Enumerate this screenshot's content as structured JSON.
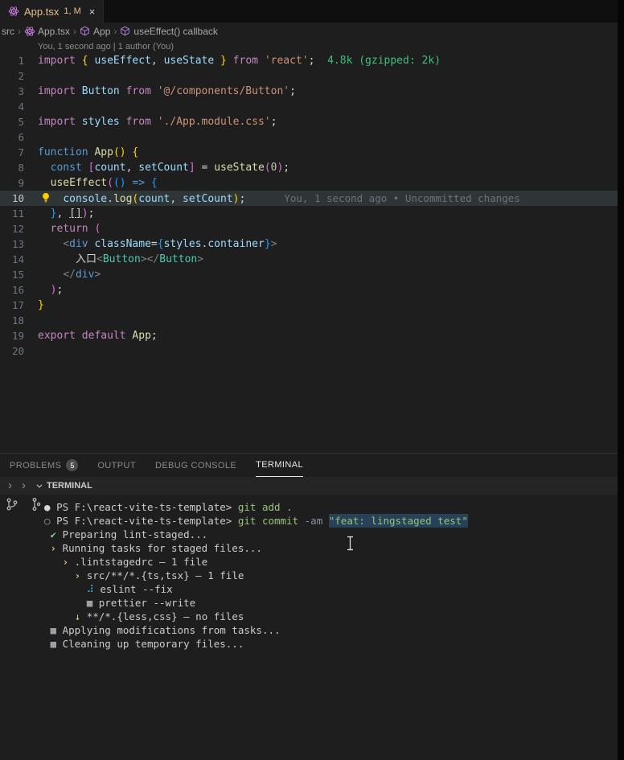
{
  "tab": {
    "title": "App.tsx",
    "badge": "1, M",
    "close_glyph": "×",
    "icon": "react-icon"
  },
  "breadcrumbs": {
    "separator": "›",
    "items": [
      {
        "label": "src"
      },
      {
        "label": "App.tsx",
        "icon": "react"
      },
      {
        "label": "App",
        "icon": "method"
      },
      {
        "label": "useEffect() callback",
        "icon": "method"
      }
    ]
  },
  "editor": {
    "codelens": "You, 1 second ago | 1 author (You)",
    "import_cost": "4.8k (gzipped: 2k)",
    "blame_annotation": "You, 1 second ago • Uncommitted changes",
    "lines": [
      {
        "n": 1,
        "t": [
          [
            "import ",
            "kw"
          ],
          [
            "{ ",
            "b1"
          ],
          [
            "useEffect",
            "var"
          ],
          [
            ", ",
            "pun"
          ],
          [
            "useState",
            "var"
          ],
          [
            " } ",
            "b1"
          ],
          [
            "from ",
            "kw"
          ],
          [
            "'react'",
            "str"
          ],
          [
            ";",
            "pun"
          ],
          [
            "  4.8k (gzipped: 2k)",
            "cost"
          ]
        ]
      },
      {
        "n": 2,
        "t": []
      },
      {
        "n": 3,
        "t": [
          [
            "import ",
            "kw"
          ],
          [
            "Button",
            "var"
          ],
          [
            " from ",
            "kw"
          ],
          [
            "'@/components/Button'",
            "str"
          ],
          [
            ";",
            "pun"
          ]
        ]
      },
      {
        "n": 4,
        "t": []
      },
      {
        "n": 5,
        "t": [
          [
            "import ",
            "kw"
          ],
          [
            "styles",
            "var"
          ],
          [
            " from ",
            "kw"
          ],
          [
            "'./App.module.css'",
            "str"
          ],
          [
            ";",
            "pun"
          ]
        ]
      },
      {
        "n": 6,
        "t": []
      },
      {
        "n": 7,
        "t": [
          [
            "function ",
            "kw2"
          ],
          [
            "App",
            "fn"
          ],
          [
            "() {",
            "b1"
          ]
        ]
      },
      {
        "n": 8,
        "t": [
          [
            "  ",
            "pun"
          ],
          [
            "const ",
            "kw2"
          ],
          [
            "[",
            "b2"
          ],
          [
            "count",
            "var"
          ],
          [
            ", ",
            "pun"
          ],
          [
            "setCount",
            "var"
          ],
          [
            "]",
            "b2"
          ],
          [
            " = ",
            "pun"
          ],
          [
            "useState",
            "fn"
          ],
          [
            "(",
            "b2"
          ],
          [
            "0",
            "num"
          ],
          [
            ")",
            "b2"
          ],
          [
            ";",
            "pun"
          ]
        ]
      },
      {
        "n": 9,
        "t": [
          [
            "  ",
            "pun"
          ],
          [
            "useEffect",
            "fn"
          ],
          [
            "(",
            "b2"
          ],
          [
            "()",
            "b3"
          ],
          [
            " ",
            "pun"
          ],
          [
            "=>",
            "kw2"
          ],
          [
            " ",
            "pun"
          ],
          [
            "{",
            "b3"
          ]
        ]
      },
      {
        "n": 10,
        "current": true,
        "lightbulb": true,
        "blame": "You, 1 second ago • Uncommitted changes",
        "t": [
          [
            "    ",
            "pun"
          ],
          [
            "console",
            "var"
          ],
          [
            ".",
            "pun"
          ],
          [
            "log",
            "fn"
          ],
          [
            "(",
            "b1"
          ],
          [
            "count",
            "var"
          ],
          [
            ", ",
            "pun"
          ],
          [
            "setCount",
            "var"
          ],
          [
            ")",
            "b1"
          ],
          [
            ";",
            "pun"
          ]
        ]
      },
      {
        "n": 11,
        "t": [
          [
            "  ",
            "pun"
          ],
          [
            "}",
            "b3"
          ],
          [
            ", ",
            "pun"
          ],
          [
            "[]",
            "lnk"
          ],
          [
            ")",
            "b2"
          ],
          [
            ";",
            "pun"
          ]
        ]
      },
      {
        "n": 12,
        "t": [
          [
            "  ",
            "pun"
          ],
          [
            "return ",
            "kw"
          ],
          [
            "(",
            "b2"
          ]
        ]
      },
      {
        "n": 13,
        "t": [
          [
            "    ",
            "pun"
          ],
          [
            "<",
            "jsxp"
          ],
          [
            "div",
            "tag"
          ],
          [
            " ",
            "pun"
          ],
          [
            "className",
            "var"
          ],
          [
            "=",
            "pun"
          ],
          [
            "{",
            "b3"
          ],
          [
            "styles",
            "var"
          ],
          [
            ".",
            "pun"
          ],
          [
            "container",
            "var"
          ],
          [
            "}",
            "b3"
          ],
          [
            ">",
            "jsxp"
          ]
        ]
      },
      {
        "n": 14,
        "t": [
          [
            "      ",
            "pun"
          ],
          [
            "入口",
            "plain"
          ],
          [
            "<",
            "jsxp"
          ],
          [
            "Button",
            "comp"
          ],
          [
            "></",
            "jsxp"
          ],
          [
            "Button",
            "comp"
          ],
          [
            ">",
            "jsxp"
          ]
        ]
      },
      {
        "n": 15,
        "t": [
          [
            "    ",
            "pun"
          ],
          [
            "</",
            "jsxp"
          ],
          [
            "div",
            "tag"
          ],
          [
            ">",
            "jsxp"
          ]
        ]
      },
      {
        "n": 16,
        "t": [
          [
            "  ",
            "pun"
          ],
          [
            ")",
            "b2"
          ],
          [
            ";",
            "pun"
          ]
        ]
      },
      {
        "n": 17,
        "t": [
          [
            "}",
            "b1"
          ]
        ]
      },
      {
        "n": 18,
        "t": []
      },
      {
        "n": 19,
        "t": [
          [
            "export ",
            "kw"
          ],
          [
            "default ",
            "kw"
          ],
          [
            "App",
            "fn"
          ],
          [
            ";",
            "pun"
          ]
        ]
      },
      {
        "n": 20,
        "t": []
      }
    ]
  },
  "panel": {
    "tabs": [
      {
        "label": "PROBLEMS",
        "badge": "5"
      },
      {
        "label": "OUTPUT"
      },
      {
        "label": "DEBUG CONSOLE"
      },
      {
        "label": "TERMINAL",
        "active": true
      }
    ]
  },
  "terminal": {
    "header": {
      "chevron1": "›",
      "chevron2": "›",
      "label": "TERMINAL"
    },
    "lines": [
      {
        "pad": 0,
        "icon": {
          "ch": "●",
          "cls": "ti-dot",
          "name": "command-decoration-icon"
        },
        "t": [
          [
            "PS F:\\react-vite-ts-template> ",
            "tp"
          ],
          [
            "git add .",
            "tcmd"
          ]
        ]
      },
      {
        "pad": 0,
        "icon": {
          "ch": "○",
          "cls": "ti-dot2",
          "name": "command-decoration-icon"
        },
        "t": [
          [
            "PS F:\\react-vite-ts-template> ",
            "tp"
          ],
          [
            "git commit ",
            "tcmd"
          ],
          [
            "-am ",
            "targ"
          ],
          [
            "\"feat: lingstaged test\"",
            "tstr"
          ]
        ]
      },
      {
        "pad": 1,
        "icon": {
          "ch": "✔",
          "cls": "ti-check",
          "name": "check-icon"
        },
        "t": [
          [
            "Preparing lint-staged...",
            "tp"
          ]
        ]
      },
      {
        "pad": 1,
        "icon": {
          "ch": "›",
          "cls": "ti-chev",
          "name": "chevron-right-icon"
        },
        "t": [
          [
            "Running tasks for staged files...",
            "tp"
          ]
        ]
      },
      {
        "pad": 3,
        "icon": {
          "ch": "›",
          "cls": "ti-chev",
          "name": "chevron-right-icon"
        },
        "t": [
          [
            ".lintstagedrc — 1 file",
            "tp"
          ]
        ]
      },
      {
        "pad": 5,
        "icon": {
          "ch": "›",
          "cls": "ti-chev",
          "name": "chevron-right-icon"
        },
        "t": [
          [
            "src/**/*.{ts,tsx} — 1 file",
            "tp"
          ]
        ]
      },
      {
        "pad": 7,
        "icon": {
          "ch": "⠼",
          "cls": "ti-spin",
          "name": "spinner-icon"
        },
        "t": [
          [
            "eslint --fix",
            "tp"
          ]
        ]
      },
      {
        "pad": 7,
        "icon": {
          "ch": "■",
          "cls": "ti-square",
          "name": "task-square-icon"
        },
        "t": [
          [
            "prettier --write",
            "tp"
          ]
        ]
      },
      {
        "pad": 5,
        "icon": {
          "ch": "↓",
          "cls": "ti-down",
          "name": "down-arrow-icon"
        },
        "t": [
          [
            "**/*.{less,css} — no files",
            "tp"
          ]
        ]
      },
      {
        "pad": 1,
        "icon": {
          "ch": "■",
          "cls": "ti-square",
          "name": "task-square-icon"
        },
        "t": [
          [
            "Applying modifications from tasks...",
            "tp"
          ]
        ]
      },
      {
        "pad": 1,
        "icon": {
          "ch": "■",
          "cls": "ti-square",
          "name": "task-square-icon"
        },
        "t": [
          [
            "Cleaning up temporary files...",
            "tp"
          ]
        ]
      }
    ]
  },
  "colors": {
    "modified_tab": "#e2c08d",
    "keyword": "#c586c0",
    "string": "#ce9178",
    "component_teal": "#4ec9b0",
    "import_cost_green": "#3fbf7f",
    "check_green": "#73c991",
    "task_yellow": "#e5c07b",
    "background": "#1e1e1e"
  }
}
